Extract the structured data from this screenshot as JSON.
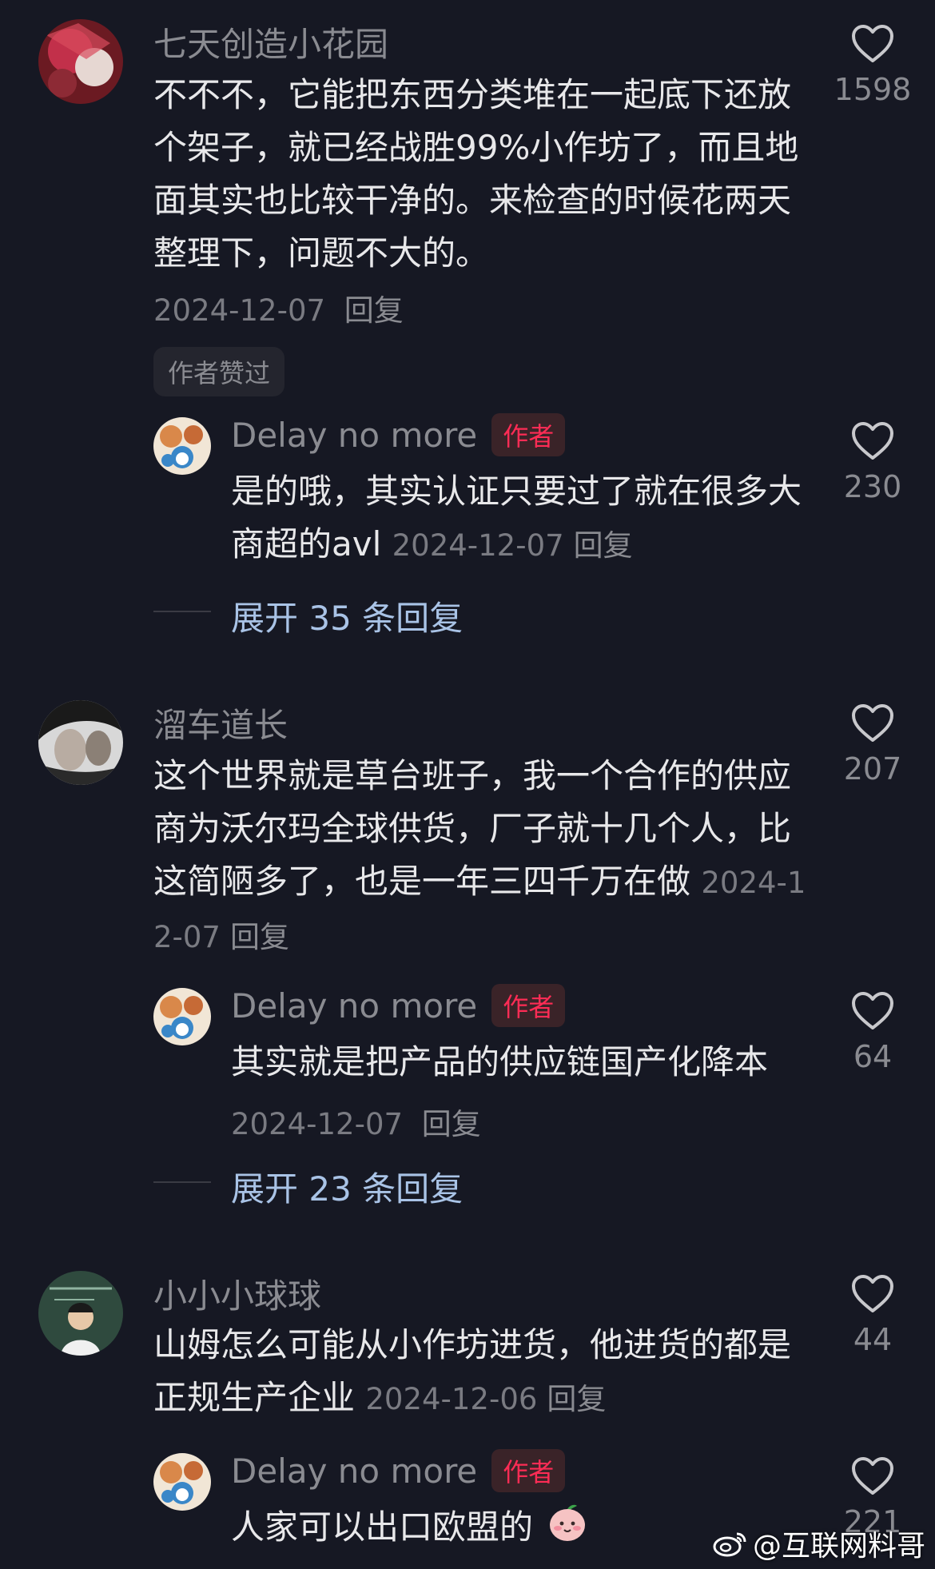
{
  "comments": [
    {
      "user": "七天创造小花园",
      "text": "不不不，它能把东西分类堆在一起底下还放个架子，就已经战胜99%小作坊了，而且地面其实也比较干净的。来检查的时候花两天整理下，问题不大的。",
      "date": "2024-12-07",
      "reply_label": "回复",
      "likes": "1598",
      "badge": "作者赞过",
      "reply": {
        "user": "Delay no more",
        "tag": "作者",
        "text": "是的哦，其实认证只要过了就在很多大商超的avl",
        "date": "2024-12-07",
        "reply_label": "回复",
        "likes": "230"
      },
      "expand": "展开 35 条回复"
    },
    {
      "user": "溜车道长",
      "text": "这个世界就是草台班子，我一个合作的供应商为沃尔玛全球供货，厂子就十几个人，比这简陋多了，也是一年三四千万在做",
      "date": "2024-12-07",
      "reply_label": "回复",
      "likes": "207",
      "reply": {
        "user": "Delay no more",
        "tag": "作者",
        "text": "其实就是把产品的供应链国产化降本",
        "date": "2024-12-07",
        "reply_label": "回复",
        "likes": "64"
      },
      "expand": "展开 23 条回复"
    },
    {
      "user": "小小小球球",
      "text": "山姆怎么可能从小作坊进货，他进货的都是正规生产企业",
      "date": "2024-12-06",
      "reply_label": "回复",
      "likes": "44",
      "reply": {
        "user": "Delay no more",
        "tag": "作者",
        "text": "人家可以出口欧盟的",
        "emoji": "peach-face-emoji",
        "likes": "221"
      }
    }
  ],
  "watermark": "@互联网料哥",
  "colors": {
    "background": "#161823",
    "author_tag": "#fe2c55",
    "expand_link": "#a9c3e6"
  }
}
